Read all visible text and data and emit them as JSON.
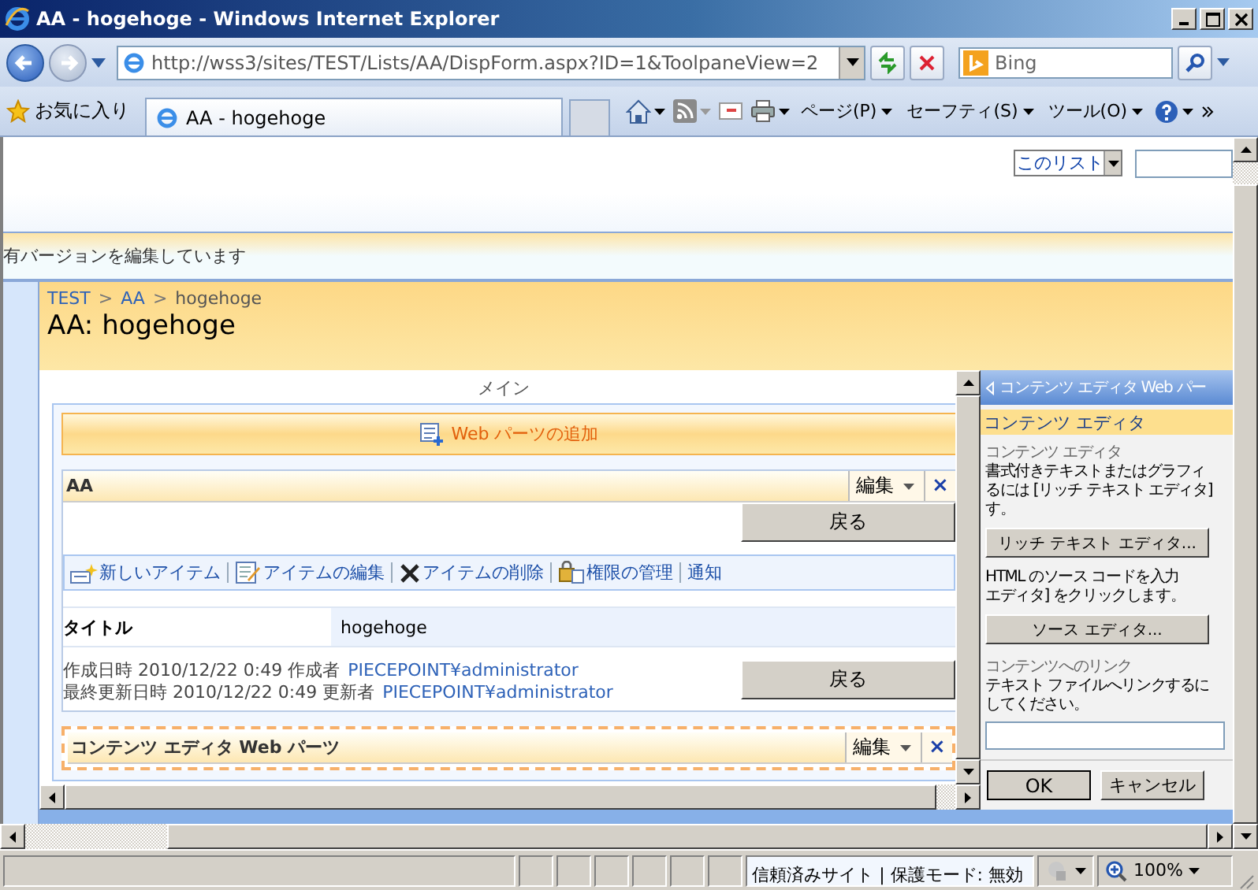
{
  "window": {
    "title": "AA - hogehoge - Windows Internet Explorer"
  },
  "address_bar": {
    "url": "http://wss3/sites/TEST/Lists/AA/DispForm.aspx?ID=1&ToolpaneView=2"
  },
  "search_box": {
    "placeholder": "Bing"
  },
  "favorites_bar": {
    "favorites_label": "お気に入り",
    "tab_title": "AA - hogehoge",
    "commands": [
      "ページ(P)",
      "セーフティ(S)",
      "ツール(O)"
    ]
  },
  "page": {
    "scope_dropdown": "このリスト",
    "banner_text": "有バージョンを編集しています",
    "breadcrumb_separator": ">",
    "breadcrumb": [
      {
        "label": "TEST",
        "link": true
      },
      {
        "label": "AA",
        "link": true
      },
      {
        "label": "hogehoge",
        "link": false
      }
    ],
    "page_title": "AA: hogehoge",
    "zone_label": "メイン",
    "add_web_part": "Web パーツの追加",
    "list_web_part": {
      "title": "AA",
      "edit_menu": "編集",
      "close": "×",
      "back_button": "戻る",
      "toolbar": [
        {
          "label": "新しいアイテム",
          "kind": "new"
        },
        {
          "label": "アイテムの編集",
          "kind": "edit"
        },
        {
          "label": "アイテムの削除",
          "kind": "delete"
        },
        {
          "label": "権限の管理",
          "kind": "permissions"
        },
        {
          "label": "通知",
          "kind": "text"
        }
      ],
      "fields": [
        {
          "label": "タイトル",
          "value": "hogehoge"
        }
      ],
      "meta": [
        {
          "label": "作成日時 2010/12/22 0:49  作成者",
          "user": "PIECEPOINT¥administrator"
        },
        {
          "label": "最終更新日時 2010/12/22 0:49  更新者",
          "user": "PIECEPOINT¥administrator"
        }
      ],
      "back_button_2": "戻る"
    },
    "content_editor_web_part": {
      "title": "コンテンツ エディタ Web パーツ",
      "edit_menu": "編集",
      "close": "×"
    }
  },
  "tool_pane": {
    "header": "コンテンツ エディタ Web パー",
    "section": "コンテンツ エディタ",
    "heading": "コンテンツ エディタ",
    "rich_text_lines": [
      "書式付きテキストまたはグラフィ",
      "るには [リッチ テキスト エディタ]",
      "す。"
    ],
    "rich_text_button": "リッチ テキスト エディタ...",
    "source_lines": [
      "HTML のソース コードを入力",
      "エディタ] をクリックします。"
    ],
    "source_button": "ソース エディタ...",
    "link_heading": "コンテンツへのリンク",
    "link_lines": [
      "テキスト ファイルへリンクするに",
      "してください。"
    ],
    "ok_button": "OK",
    "cancel_button": "キャンセル"
  },
  "status_bar": {
    "zone": "信頼済みサイト | 保護モード: 無効",
    "zoom": "100%"
  }
}
